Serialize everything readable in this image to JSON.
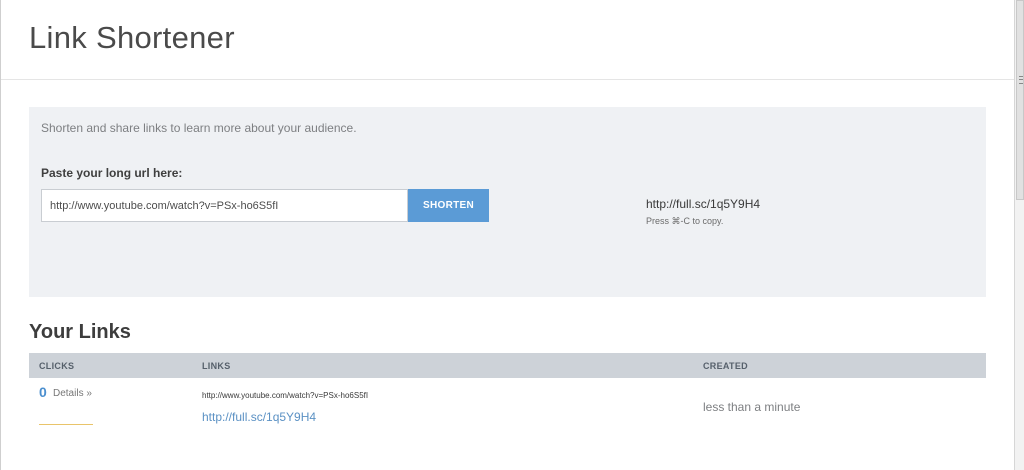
{
  "header": {
    "title": "Link Shortener"
  },
  "shortener": {
    "intro": "Shorten and share links to learn more about your audience.",
    "input_label": "Paste your long url here:",
    "input_value": "http://www.youtube.com/watch?v=PSx-ho6S5fI",
    "button_label": "SHORTEN",
    "result_link": "http://full.sc/1q5Y9H4",
    "copy_hint": "Press ⌘-C to copy."
  },
  "links": {
    "title": "Your Links",
    "columns": {
      "clicks": "CLICKS",
      "links": "LINKS",
      "created": "CREATED"
    },
    "rows": [
      {
        "clicks": "0",
        "details": "Details »",
        "long_url": "http://www.youtube.com/watch?v=PSx-ho6S5fI",
        "short_url": "http://full.sc/1q5Y9H4",
        "created": "less than a minute"
      }
    ]
  },
  "colors": {
    "accent": "#5b9bd6",
    "link": "#5b91c4",
    "panel": "#eff1f4",
    "table_header": "#cdd2d8"
  },
  "icons": {
    "scroll_grip": "grip-icon"
  }
}
